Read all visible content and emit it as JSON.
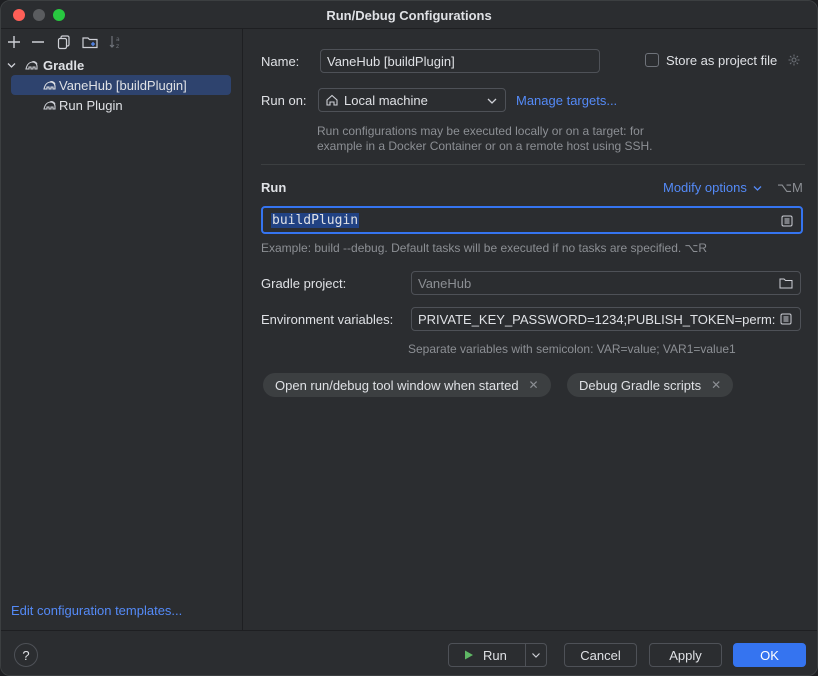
{
  "window": {
    "title": "Run/Debug Configurations"
  },
  "sidebar": {
    "toolbar_icons": [
      "add-icon",
      "remove-icon",
      "copy-icon",
      "folder-add-icon",
      "sort-icon"
    ],
    "tree": {
      "group_label": "Gradle",
      "items": [
        {
          "label": "VaneHub [buildPlugin]",
          "selected": true
        },
        {
          "label": "Run Plugin",
          "selected": false
        }
      ]
    },
    "edit_templates_label": "Edit configuration templates..."
  },
  "form": {
    "name_label": "Name:",
    "name_value": "VaneHub [buildPlugin]",
    "store_label": "Store as project file",
    "run_on_label": "Run on:",
    "run_on_value": "Local machine",
    "manage_targets_label": "Manage targets...",
    "run_on_hint_line1": "Run configurations may be executed locally or on a target: for",
    "run_on_hint_line2": "example in a Docker Container or on a remote host using SSH.",
    "run_section_label": "Run",
    "modify_options_label": "Modify options",
    "modify_options_shortcut": "⌥M",
    "tasks_value": "buildPlugin",
    "tasks_hint": "Example: build --debug. Default tasks will be executed if no tasks are specified. ⌥R",
    "gradle_project_label": "Gradle project:",
    "gradle_project_value": "VaneHub",
    "env_label": "Environment variables:",
    "env_value": "PRIVATE_KEY_PASSWORD=1234;PUBLISH_TOKEN=perm:",
    "env_hint": "Separate variables with semicolon: VAR=value; VAR1=value1",
    "chips": [
      {
        "label": "Open run/debug tool window when started"
      },
      {
        "label": "Debug Gradle scripts"
      }
    ]
  },
  "footer": {
    "help_label": "?",
    "run_label": "Run",
    "cancel_label": "Cancel",
    "apply_label": "Apply",
    "ok_label": "OK"
  },
  "colors": {
    "background": "#2b2d30",
    "selection": "#2e436e",
    "link": "#548af7",
    "primary_button": "#3574f0",
    "text_highlight": "#214283"
  }
}
